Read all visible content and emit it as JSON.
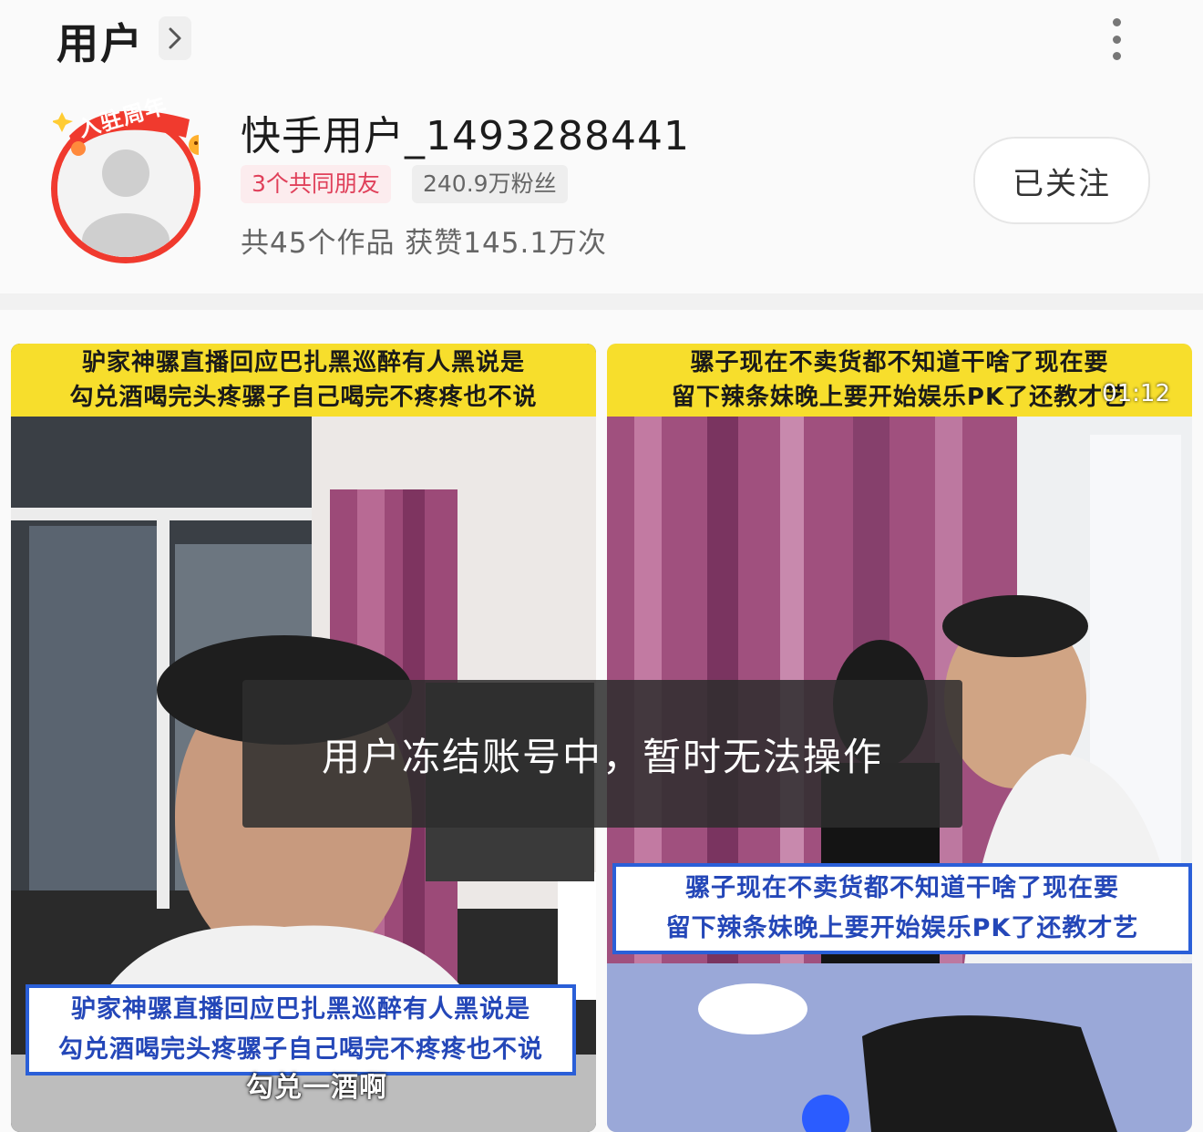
{
  "header": {
    "title": "用户",
    "chevron_icon": "chevron-right-icon",
    "more_icon": "more-vertical-icon"
  },
  "profile": {
    "badge_text": "入驻周年",
    "username": "快手用户_1493288441",
    "mutual_friends": "3个共同朋友",
    "fans": "240.9万粉丝",
    "stats": "共45个作品 获赞145.1万次",
    "follow_label": "已关注"
  },
  "videos": [
    {
      "top_caption_line1": "驴家神骡直播回应巴扎黑巡醉有人黑说是",
      "top_caption_line2": "勾兑酒喝完头疼骡子自己喝完不疼疼也不说",
      "bottom_caption_line1": "驴家神骡直播回应巴扎黑巡醉有人黑说是",
      "bottom_caption_line2": "勾兑酒喝完头疼骡子自己喝完不疼疼也不说",
      "subtitle": "勾兑一酒啊"
    },
    {
      "top_caption_line1": "骡子现在不卖货都不知道干啥了现在要",
      "top_caption_line2": "留下辣条妹晚上要开始娱乐PK了还教才艺",
      "duration": "01:12",
      "bottom_caption_line1": "骡子现在不卖货都不知道干啥了现在要",
      "bottom_caption_line2": "留下辣条妹晚上要开始娱乐PK了还教才艺"
    }
  ],
  "toast": {
    "message": "用户冻结账号中，暂时无法操作"
  },
  "colors": {
    "accent_red": "#f03a2e",
    "friends_tag": "#e0405a",
    "caption_yellow": "#f7de2c",
    "caption_blue": "#2a5fd8"
  }
}
